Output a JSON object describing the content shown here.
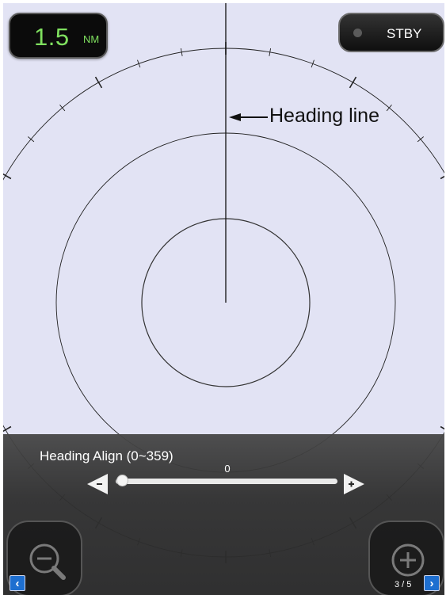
{
  "range": {
    "value": "1.5",
    "unit": "NM"
  },
  "status_button": {
    "label": "STBY"
  },
  "radar": {
    "heading_callout": "Heading line",
    "colors": {
      "background": "#e2e3f4",
      "rings": "#222222"
    }
  },
  "heading_align": {
    "title": "Heading Align (0~359)",
    "value": "0",
    "min": 0,
    "max": 359,
    "decrease_icon": "left-arrow-minus-icon",
    "increase_icon": "right-arrow-plus-icon"
  },
  "zoom": {
    "out_icon": "zoom-out-icon",
    "in_icon": "zoom-in-icon"
  },
  "pagination": {
    "indicator": "3 / 5",
    "prev_icon": "chevron-left-icon",
    "next_icon": "chevron-right-icon"
  },
  "colors": {
    "range_text": "#7fe05f",
    "panel": "#3a3a3a",
    "nav_blue": "#1e6fd0"
  }
}
